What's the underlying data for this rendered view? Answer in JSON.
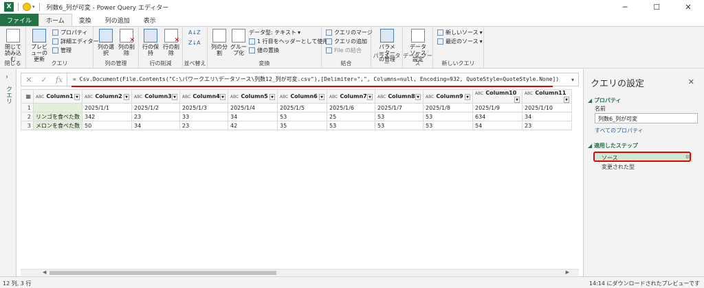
{
  "window": {
    "title": "列数6_列が可変 - Power Query エディター",
    "minimize": "─",
    "maximize": "☐",
    "close": "✕"
  },
  "tabs": [
    "ファイル",
    "ホーム",
    "変換",
    "列の追加",
    "表示"
  ],
  "ribbon": {
    "close_load": "閉じて読み込む",
    "close_group": "閉じる",
    "preview_refresh": "プレビューの更新",
    "properties": "プロパティ",
    "advanced_editor": "詳細エディター",
    "manage": "管理",
    "query_group": "クエリ",
    "choose_columns": "列の選択",
    "remove_columns": "列の削除",
    "columns_group": "列の管理",
    "keep_rows": "行の保持",
    "remove_rows": "行の削除",
    "rows_group": "行の削減",
    "sort_group": "並べ替え",
    "split_column": "列の分割",
    "group_by": "グループ化",
    "data_type": "データ型: テキスト",
    "use_first_row": "1 行目をヘッダーとして使用",
    "replace_values": "値の置換",
    "transform_group": "変換",
    "merge_queries": "クエリのマージ",
    "append_queries": "クエリの追加",
    "combine_files": "File の結合",
    "combine_group": "結合",
    "manage_parameters": "パラメーターの管理",
    "parameters_group": "パラメーター",
    "data_source_settings": "データ ソース設定",
    "data_source_group": "データ ソース",
    "new_source": "新しいソース",
    "recent_sources": "最近のソース",
    "new_query_group": "新しいクエリ"
  },
  "left_pane": {
    "label": "クエリ"
  },
  "formula_bar": {
    "formula": "= Csv.Document(File.Contents(\"C:\\パワークエリ\\データソース\\列数12_列が可変.csv\"),[Delimiter=\",\", Columns=null, Encoding=932, QuoteStyle=QuoteStyle.None])"
  },
  "grid": {
    "type_label": "ABC",
    "columns": [
      "Column1",
      "Column2",
      "Column3",
      "Column4",
      "Column5",
      "Column6",
      "Column7",
      "Column8",
      "Column9",
      "Column10",
      "Column11"
    ],
    "rows": [
      [
        "1",
        "",
        "2025/1/1",
        "2025/1/2",
        "2025/1/3",
        "2025/1/4",
        "2025/1/5",
        "2025/1/6",
        "2025/1/7",
        "2025/1/8",
        "2025/1/9",
        "2025/1/10"
      ],
      [
        "2",
        "リンゴを食べた数",
        "342",
        "23",
        "33",
        "34",
        "53",
        "25",
        "53",
        "53",
        "634",
        "34"
      ],
      [
        "3",
        "メロンを食べた数",
        "50",
        "34",
        "23",
        "42",
        "35",
        "53",
        "53",
        "53",
        "54",
        "23"
      ]
    ]
  },
  "settings": {
    "title": "クエリの設定",
    "properties_header": "プロパティ",
    "name_label": "名前",
    "name_value": "列数6_列が可変",
    "all_properties": "すべてのプロパティ",
    "applied_steps_header": "適用したステップ",
    "steps": [
      "ソース",
      "変更された型"
    ]
  },
  "status": {
    "left": "12 列, 3 行",
    "right": "14:14 にダウンロードされたプレビューです"
  }
}
